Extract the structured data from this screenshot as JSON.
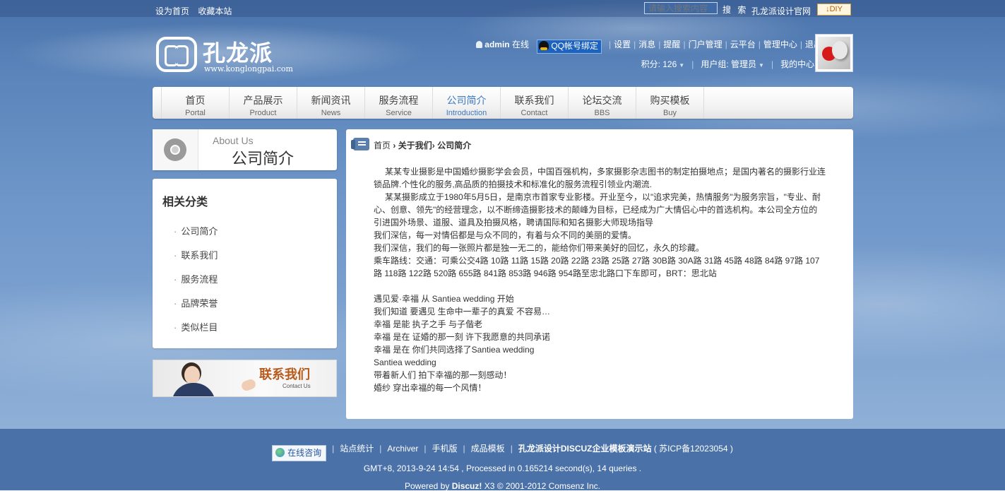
{
  "topbar": {
    "links": [
      "设为首页",
      "收藏本站"
    ],
    "search_placeholder": "请输入搜索内容",
    "search_button": "搜 索",
    "site_link": "孔龙派设计官网",
    "diy_label": "DIY"
  },
  "logo": {
    "name": "孔龙派",
    "url": "www.konglongpai.com"
  },
  "user": {
    "username": "admin",
    "status": "在线",
    "qq_bind": "QQ帐号绑定",
    "links": [
      "设置",
      "消息",
      "提醒",
      "门户管理",
      "云平台",
      "管理中心",
      "退出"
    ],
    "points": "积分: 126",
    "group": "用户组: 管理员",
    "my_center": "我的中心"
  },
  "nav": [
    {
      "cn": "首页",
      "en": "Portal"
    },
    {
      "cn": "产品展示",
      "en": "Product"
    },
    {
      "cn": "新闻资讯",
      "en": "News"
    },
    {
      "cn": "服务流程",
      "en": "Service"
    },
    {
      "cn": "公司简介",
      "en": "Introduction"
    },
    {
      "cn": "联系我们",
      "en": "Contact"
    },
    {
      "cn": "论坛交流",
      "en": "BBS"
    },
    {
      "cn": "购买模板",
      "en": "Buy"
    }
  ],
  "sidebar": {
    "about_en": "About Us",
    "about_cn": "公司简介",
    "category_title": "相关分类",
    "categories": [
      "公司简介",
      "联系我们",
      "服务流程",
      "品牌荣誉",
      "类似栏目"
    ],
    "contact_cn": "联系我们",
    "contact_en": "Contact Us"
  },
  "breadcrumb": {
    "home": "首页",
    "arrow1": "›",
    "section": "关于我们",
    "arrow2": "›",
    "current": "公司简介"
  },
  "article": {
    "p1": "某某专业摄影是中国婚纱摄影学会会员，中国百强机构，多家摄影杂志图书的制定拍摄地点；是国内著名的摄影行业连锁品牌.个性化的服务,高品质的拍摄技术和标准化的服务流程引领业内潮流.",
    "p2": "某某摄影成立于1980年5月5日，是南京市首家专业影楼。开业至今，以\"追求完美，热情服务\"为服务宗旨，\"专业、耐心、创意、领先\"的经营理念，以不断缔造摄影技术的颠峰为目标，已经成为广大情侣心中的首选机构。本公司全方位的引进国外场景、道服、道具及拍摄风格，聘请国际和知名摄影大师现场指导",
    "l3": "我们深信，每一对情侣都是与众不同的，有着与众不同的美丽的爱情。",
    "l4": "我们深信，我们的每一张照片都是独一无二的，能给你们带来美好的回忆，永久的珍藏。",
    "l5": "乘车路线：交通：可乘公交4路 10路 11路 15路 20路 22路 23路 25路 27路 30B路 30A路 31路 45路 48路 84路 97路 107路 118路 122路 520路 655路 841路 853路 946路 954路至忠北路口下车即可，BRT：思北站",
    "poem": [
      "遇见爱·幸福 从 Santiea wedding 开始",
      "我们知道 要遇见 生命中一辈子的真爱 不容易…",
      "幸福 是能 执子之手 与子偕老",
      "幸福 是在 证婚的那一刻 许下我愿意的共同承诺",
      "幸福 是在 你们共同选择了Santiea wedding",
      "Santiea wedding",
      "带着新人们 拍下幸福的那一刻感动！",
      "婚纱 穿出幸福的每一个风情！"
    ]
  },
  "footer": {
    "online": "在线咨询",
    "links": [
      "站点统计",
      "Archiver",
      "手机版",
      "成品模板"
    ],
    "site_name": "孔龙派设计DISCUZ企业模板演示站",
    "icp": "( 苏ICP备12023054 )",
    "stats": "GMT+8, 2013-9-24 14:54 , Processed in 0.165214 second(s), 14 queries .",
    "powered_prefix": "Powered by",
    "powered_brand": "Discuz!",
    "powered_suffix": "X3 © 2001-2012 Comsenz Inc."
  },
  "colors": {
    "sky_top": "#4a73ab",
    "footer_bg": "#4b72a8",
    "nav_active": "#3a78c3",
    "contact_accent": "#b85a1c"
  }
}
